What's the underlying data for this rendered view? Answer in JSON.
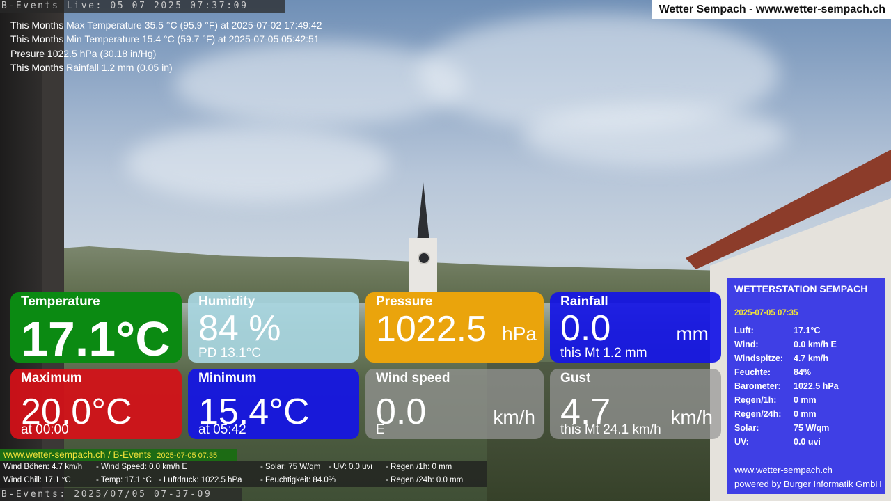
{
  "header": {
    "live_bar": "B-Events Live: 05 07 2025 07:37:09",
    "site_title": "Wetter Sempach - www.wetter-sempach.ch"
  },
  "stats": [
    "This Months Max Temperature 35.5 °C (95.9 °F) at 2025-07-02 17:49:42",
    "This Months Min Temperature 15.4 °C (59.7 °F) at 2025-07-05 05:42:51",
    "Presure 1022.5 hPa (30.18 in/Hg)",
    "This Months Rainfall 1.2 mm (0.05 in)"
  ],
  "tiles": {
    "temperature": {
      "label": "Temperature",
      "value": "17.1°C"
    },
    "humidity": {
      "label": "Humidity",
      "value": "84 %",
      "sub": "PD 13.1°C"
    },
    "pressure": {
      "label": "Pressure",
      "value": "1022.5",
      "unit": "hPa"
    },
    "rainfall": {
      "label": "Rainfall",
      "value": "0.0",
      "unit": "mm",
      "sub": "this Mt 1.2 mm"
    },
    "maximum": {
      "label": "Maximum",
      "value": "20.0°C",
      "sub": "at 00:00"
    },
    "minimum": {
      "label": "Minimum",
      "value": "15.4°C",
      "sub": "at 05:42"
    },
    "windspeed": {
      "label": "Wind speed",
      "value": "0.0",
      "unit": "km/h",
      "sub": "E"
    },
    "gust": {
      "label": "Gust",
      "value": "4.7",
      "unit": "km/h",
      "sub": "this Mt 24.1 km/h"
    }
  },
  "colors": {
    "green": "#0b8a12",
    "lightblue": "#a8d6e1",
    "orange": "#eaa40c",
    "blue": "#1414e6",
    "red": "#d61018",
    "gray": "#969696",
    "yellow": "#f1e23a"
  },
  "bottom": {
    "link": "www.wetter-sempach.ch / B-Events",
    "timestamp": "2025-07-05 07:35",
    "row1": {
      "wind_boehen": "Wind Böhen: 4.7 km/h",
      "wind_speed": "- Wind Speed: 0.0 km/h E",
      "solar": "- Solar: 75 W/qm",
      "uv": "- UV: 0.0 uvi",
      "regen1h": "- Regen /1h:   0 mm"
    },
    "row2": {
      "wind_chill": "Wind Chill: 17.1 °C",
      "temp": "- Temp: 17.1 °C",
      "luftdruck": "- Luftdruck: 1022.5 hPa",
      "feuchtigkeit": "- Feuchtigkeit: 84.0%",
      "regen24h": "- Regen /24h: 0.0 mm"
    },
    "status_bar": "B-Events: 2025/07/05 07-37-09"
  },
  "station": {
    "title": "WETTERSTATION SEMPACH",
    "date": "2025-07-05 07:35",
    "rows": [
      {
        "k": "Luft:",
        "v": "17.1°C"
      },
      {
        "k": "Wind:",
        "v": "0.0 km/h  E"
      },
      {
        "k": "Windspitze:",
        "v": "4.7 km/h"
      },
      {
        "k": "Feuchte:",
        "v": "84%"
      },
      {
        "k": "Barometer:",
        "v": "1022.5 hPa"
      },
      {
        "k": "Regen/1h:",
        "v": "0 mm"
      },
      {
        "k": "Regen/24h:",
        "v": "0 mm"
      },
      {
        "k": "Solar:",
        "v": "75 W/qm"
      },
      {
        "k": "UV:",
        "v": "0.0 uvi"
      }
    ],
    "footer_site": "www.wetter-sempach.ch",
    "footer_credit": "powered by Burger Informatik GmbH"
  }
}
